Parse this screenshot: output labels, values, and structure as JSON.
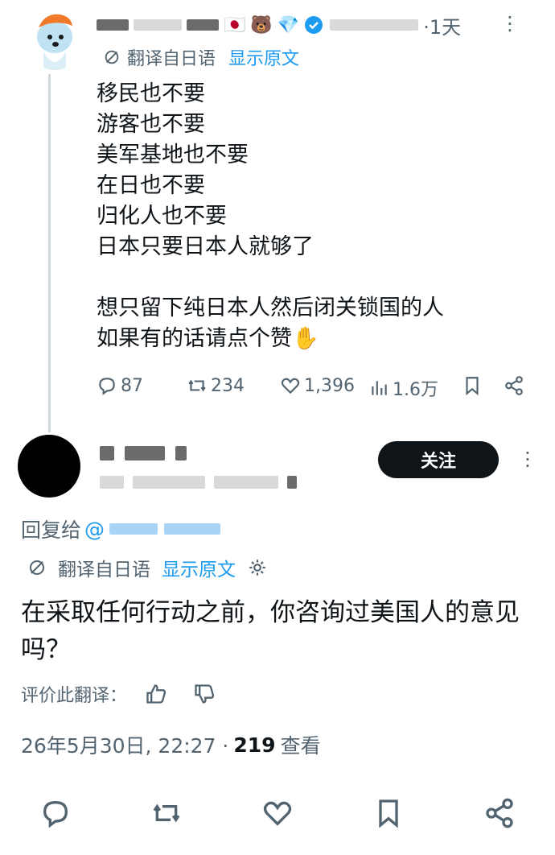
{
  "tweet1": {
    "avatar": "cartoon-dog-avatar",
    "emojis": [
      "🇯🇵",
      "🐻",
      "💎"
    ],
    "time": "·1天",
    "more": "⋮",
    "translated_from": "翻译自日语",
    "show_original": "显示原文",
    "lines": "移民也不要\n游客也不要\n美军基地也不要\n在日也不要\n归化人也不要\n日本只要日本人就够了\n\n想只留下纯日本人然后闭关锁国的人\n如果有的话请点个赞✋",
    "stats": {
      "replies": "87",
      "retweets": "234",
      "likes": "1,396",
      "views": "1.6万"
    }
  },
  "tweet2": {
    "follow_label": "关注",
    "more": "⋮",
    "reply_to_label": "回复给",
    "reply_to_at": "@",
    "translated_from": "翻译自日语",
    "show_original": "显示原文",
    "text": "在采取任何行动之前，你咨询过美国人的意见吗？",
    "rate_label": "评价此翻译：",
    "date": "26年5月30日, 22:27 ·",
    "views_count": "219",
    "views_label": "查看"
  },
  "colors": {
    "accent": "#1d9bf0",
    "muted": "#536471",
    "text": "#0f1419"
  }
}
